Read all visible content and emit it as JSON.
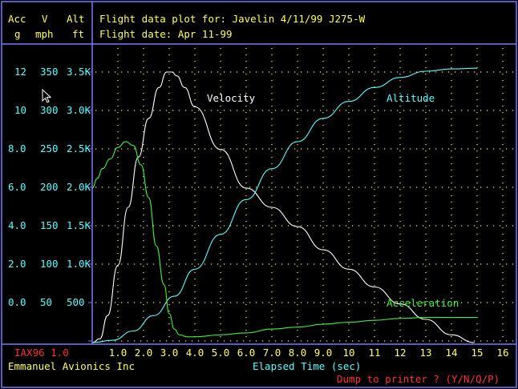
{
  "colors": {
    "frame": "#7878ff",
    "yellow": "#ffff55",
    "cyan": "#55ffff",
    "white": "#ffffff",
    "green": "#3ef03e",
    "red": "#ff3030",
    "gridDots": "#ffff55"
  },
  "header": {
    "col_acc": "Acc",
    "col_acc_unit": "g",
    "col_v": "V",
    "col_v_unit": "mph",
    "col_alt": "Alt",
    "col_alt_unit": "ft",
    "title_line1": "Flight data plot for: Javelin 4/11/99 J275-W",
    "title_line2": "Flight date: Apr 11-99"
  },
  "footer": {
    "program": "IAX96 1.0",
    "company": "Emmanuel Avionics Inc",
    "xlabel": "Elapsed Time (sec)",
    "prompt": "Dump to printer ? (Y/N/Q/P)"
  },
  "chart_data": {
    "type": "line",
    "x_ticks": [
      "1.0",
      "2.0",
      "3.0",
      "4.0",
      "5.0",
      "6.0",
      "7.0",
      "8.0",
      "9.0",
      "10",
      "11",
      "12",
      "13",
      "14",
      "15",
      "16"
    ],
    "xlim": [
      0.0,
      16.5
    ],
    "y_ticks": {
      "acc": [
        "12",
        "10",
        "8.0",
        "6.0",
        "4.0",
        "2.0",
        "0.0"
      ],
      "velocity": [
        "350",
        "300",
        "250",
        "200",
        "150",
        "100",
        "50"
      ],
      "altitude": [
        "3.5K",
        "3.0K",
        "2.5K",
        "2.0K",
        "1.5K",
        "1.0K",
        "500"
      ]
    },
    "velocity_range_mph": [
      0,
      350
    ],
    "acc_range_g": [
      -2,
      12
    ],
    "alt_range_ft": [
      0,
      3500
    ],
    "grid": true,
    "annotations": {
      "velocity": "Velocity",
      "altitude": "Altitude",
      "acceleration": "Acceleration"
    },
    "series": [
      {
        "name": "Velocity",
        "color": "#ffffff",
        "x": [
          0.0,
          0.3,
          0.6,
          1.0,
          1.4,
          1.8,
          2.2,
          2.6,
          2.9,
          3.1,
          3.3,
          3.6,
          4.0,
          5.0,
          6.0,
          7.0,
          8.0,
          9.0,
          10.0,
          11.0,
          12.0,
          13.0,
          14.0,
          14.9
        ],
        "y": [
          0,
          5,
          35,
          100,
          175,
          240,
          290,
          330,
          350,
          350,
          345,
          330,
          305,
          250,
          200,
          175,
          150,
          120,
          95,
          72,
          50,
          30,
          10,
          0
        ]
      },
      {
        "name": "Altitude",
        "color": "#55ffff",
        "x": [
          0.0,
          0.8,
          1.6,
          2.4,
          3.2,
          4.0,
          5.0,
          6.0,
          7.0,
          8.0,
          9.0,
          10.0,
          11.0,
          12.0,
          13.0,
          14.0,
          15.0
        ],
        "y": [
          0,
          30,
          150,
          350,
          600,
          950,
          1400,
          1850,
          2250,
          2600,
          2900,
          3120,
          3300,
          3430,
          3510,
          3540,
          3550
        ]
      },
      {
        "name": "Acceleration",
        "color": "#3ef03e",
        "x": [
          0.0,
          0.2,
          0.4,
          0.7,
          1.0,
          1.3,
          1.6,
          1.9,
          2.2,
          2.5,
          2.8,
          3.0,
          3.2,
          3.4,
          3.7,
          4.0,
          5.0,
          6.0,
          7.0,
          8.0,
          9.0,
          10.0,
          11.0,
          12.0,
          13.0,
          14.0,
          15.0
        ],
        "y": [
          6.0,
          6.5,
          7.0,
          7.5,
          8.1,
          8.4,
          8.2,
          7.2,
          5.5,
          3.0,
          1.0,
          -0.5,
          -1.3,
          -1.6,
          -1.7,
          -1.7,
          -1.6,
          -1.5,
          -1.3,
          -1.2,
          -1.05,
          -0.95,
          -0.85,
          -0.75,
          -0.7,
          -0.7,
          -0.7
        ]
      }
    ]
  }
}
